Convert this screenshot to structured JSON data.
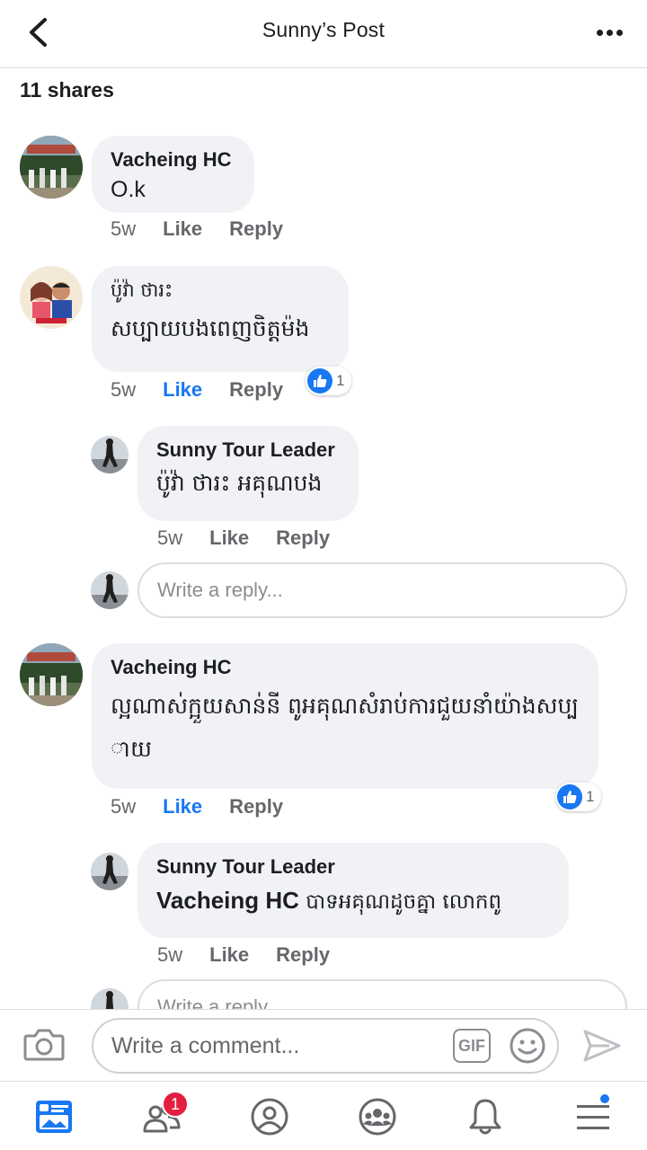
{
  "header": {
    "title": "Sunny’s Post"
  },
  "post": {
    "shares_label": "11 shares"
  },
  "comments": [
    {
      "author": "Vacheing HC",
      "text": "O.k",
      "time": "5w",
      "like": "Like",
      "reply": "Reply"
    },
    {
      "author": "ប៉ូវ៉ា ថារះ",
      "text": "សប្បាយបងពេញចិត្តម៉ង",
      "time": "5w",
      "like": "Like",
      "reply": "Reply",
      "reaction_count": "1"
    },
    {
      "author": "Sunny Tour Leader",
      "text": "ប៉ូវ៉ា ថារះ អគុណបង",
      "time": "5w",
      "like": "Like",
      "reply": "Reply"
    },
    {
      "author": "Vacheing HC",
      "text": "ល្អណាស់ក្អួយសាន់នី ពូអគុណសំរាប់ការជួយនាំយ៉ាងសប្បាយ",
      "time": "5w",
      "like": "Like",
      "reply": "Reply",
      "reaction_count": "1"
    },
    {
      "author": "Sunny Tour Leader",
      "mention": "Vacheing HC",
      "text": " បាទអគុណដូចគ្នា លោកពូ",
      "time": "5w",
      "like": "Like",
      "reply": "Reply"
    }
  ],
  "reply_placeholder": "Write a reply...",
  "composer": {
    "placeholder": "Write a comment...",
    "gif_label": "GIF"
  },
  "nav": {
    "friends_badge": "1"
  },
  "icons": [
    "back-arrow-icon",
    "more-icon",
    "camera-icon",
    "gif-icon",
    "emoji-icon",
    "send-icon",
    "news-feed-icon",
    "friends-icon",
    "profile-icon",
    "groups-icon",
    "bell-icon",
    "menu-icon",
    "like-thumb-icon"
  ],
  "colors": {
    "accent": "#1877f2",
    "bubble": "#f0f2f5",
    "meta": "#65676b",
    "badge": "#e41e3f"
  }
}
